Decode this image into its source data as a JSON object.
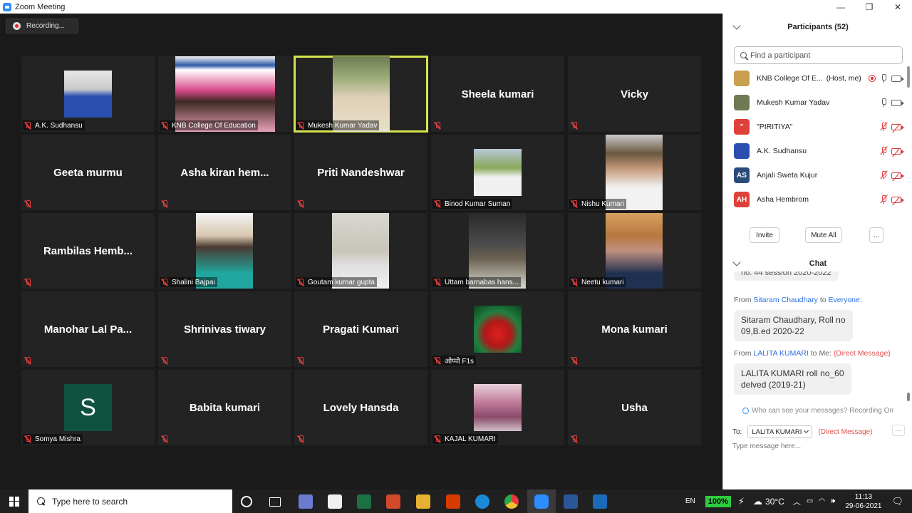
{
  "window": {
    "title": "Zoom Meeting",
    "minimize": "—",
    "maximize": "❐",
    "close": "✕"
  },
  "recording": {
    "label": "Recording..."
  },
  "tiles": [
    {
      "name": "A.K. Sudhansu",
      "kind": "video",
      "img": "sudhansu"
    },
    {
      "name": "KNB College Of Education",
      "kind": "video",
      "img": "knb"
    },
    {
      "name": "Mukesh Kumar Yadav",
      "kind": "video",
      "img": "mukesh",
      "active": true
    },
    {
      "name": "Sheela kumari",
      "kind": "name"
    },
    {
      "name": "Vicky",
      "kind": "name"
    },
    {
      "name": "Geeta murmu",
      "kind": "name"
    },
    {
      "name": "Asha  kiran  hem...",
      "kind": "name"
    },
    {
      "name": "Priti Nandeshwar",
      "kind": "name"
    },
    {
      "name": "Binod Kumar Suman",
      "kind": "video",
      "img": "binod"
    },
    {
      "name": "Nishu Kumari",
      "kind": "video",
      "img": "nishu"
    },
    {
      "name": "Rambilas  Hemb...",
      "kind": "name"
    },
    {
      "name": "Shalini Bajpai",
      "kind": "video",
      "img": "shalini"
    },
    {
      "name": "Goutam kumar gupta",
      "kind": "video",
      "img": "goutam"
    },
    {
      "name": "Uttam barnabas hans...",
      "kind": "video",
      "img": "uttam"
    },
    {
      "name": "Neetu kumari",
      "kind": "video",
      "img": "neetu"
    },
    {
      "name": "Manohar  Lal  Pa...",
      "kind": "name"
    },
    {
      "name": "Shrinivas tiwary",
      "kind": "name"
    },
    {
      "name": "Pragati Kumari",
      "kind": "name"
    },
    {
      "name": "ओप्पो F1s",
      "kind": "video",
      "img": "ompo"
    },
    {
      "name": "Mona kumari",
      "kind": "name"
    },
    {
      "name": "Somya Mishra",
      "kind": "avatar",
      "initial": "S"
    },
    {
      "name": "Babita kumari",
      "kind": "name"
    },
    {
      "name": "Lovely Hansda",
      "kind": "name"
    },
    {
      "name": "KAJAL KUMARI",
      "kind": "video",
      "img": "kajal"
    },
    {
      "name": "Usha",
      "kind": "name"
    }
  ],
  "participants": {
    "title": "Participants (52)",
    "search_placeholder": "Find a participant",
    "list": [
      {
        "name": "KNB College Of E...",
        "role": "(Host, me)",
        "avatar": "",
        "avatar_color": "#c8a050",
        "mic": "on",
        "cam": "on",
        "recording": true
      },
      {
        "name": "Mukesh Kumar Yadav",
        "avatar": "",
        "avatar_color": "#6d7a52",
        "mic": "on",
        "cam": "on"
      },
      {
        "name": "\"PIRITIYA\"",
        "avatar": "\"",
        "avatar_color": "#e0403a",
        "mic": "off",
        "cam": "off"
      },
      {
        "name": "A.K. Sudhansu",
        "avatar": "",
        "avatar_color": "#2a4fb0",
        "mic": "off",
        "cam": "off"
      },
      {
        "name": "Anjali Sweta Kujur",
        "avatar": "AS",
        "avatar_color": "#2a4a7a",
        "mic": "off",
        "cam": "off"
      },
      {
        "name": "Asha Hembrom",
        "avatar": "AH",
        "avatar_color": "#e0403a",
        "mic": "off",
        "cam": "off"
      }
    ],
    "invite": "Invite",
    "mute_all": "Mute All",
    "more": "..."
  },
  "chat": {
    "title": "Chat",
    "partial_message": "no. 44 session 2020-2022",
    "messages": [
      {
        "from_label": "From",
        "from": "Sitaram Chaudhary",
        "to_label": "to",
        "to": "Everyone:",
        "text_line1": "Sitaram Chaudhary, Roll no",
        "text_line2": "09,B.ed 2020-22"
      },
      {
        "from_label": "From",
        "from": "LALITA KUMARI",
        "to_label": "to Me:",
        "dm": "(Direct Message)",
        "text_line1": "LALITA KUMARI roll no_60",
        "text_line2": "delved  (2019-21)"
      }
    ],
    "who_can_see": "Who can see your messages? Recording On",
    "to_label": "To:",
    "to_value": "LALITA KUMARI",
    "to_dm": "(Direct Message)",
    "more": "···",
    "input_placeholder": "Type message here..."
  },
  "taskbar": {
    "search_placeholder": "Type here to search",
    "lang": "EN",
    "battery": "100%",
    "temp": "30°C",
    "time": "11:13",
    "date": "29-06-2021"
  }
}
